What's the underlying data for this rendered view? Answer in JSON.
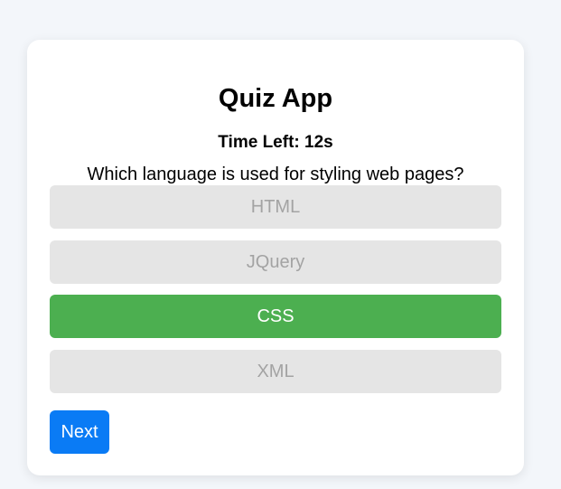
{
  "app": {
    "title": "Quiz App"
  },
  "timer": {
    "text": "Time Left: 12s"
  },
  "question": {
    "text": "Which language is used for styling web pages?"
  },
  "options": [
    {
      "label": "HTML",
      "state": "disabled"
    },
    {
      "label": "JQuery",
      "state": "disabled"
    },
    {
      "label": "CSS",
      "state": "correct"
    },
    {
      "label": "XML",
      "state": "disabled"
    }
  ],
  "controls": {
    "next_label": "Next"
  },
  "colors": {
    "correct": "#4caf50",
    "disabled_bg": "#e5e5e5",
    "disabled_text": "#a3a3a3",
    "next_button": "#0a7bf5",
    "page_bg": "#f3f6fa"
  }
}
